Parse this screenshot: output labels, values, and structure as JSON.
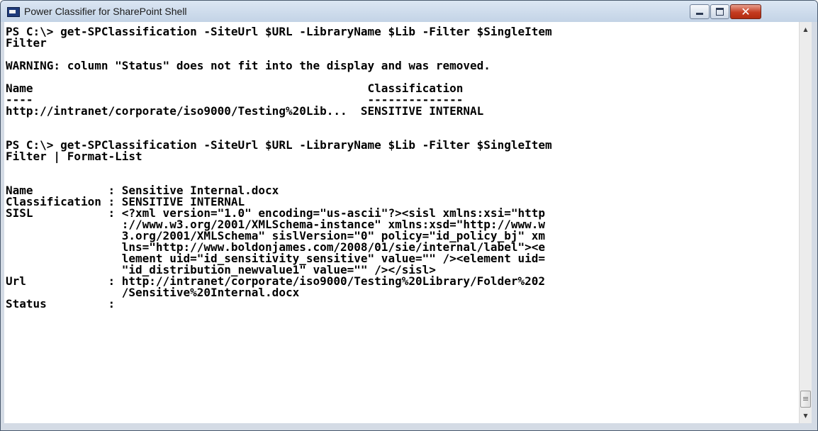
{
  "window": {
    "title": "Power Classifier for SharePoint Shell",
    "controls": {
      "minimize_icon": "minimize-icon",
      "maximize_icon": "maximize-icon",
      "close_icon": "close-icon"
    }
  },
  "console": {
    "lines": [
      "PS C:\\> get-SPClassification -SiteUrl $URL -LibraryName $Lib -Filter $SingleItem",
      "Filter",
      "WARNING: column \"Status\" does not fit into the display and was removed.",
      "Name                                                 Classification",
      "----                                                 --------------",
      "http://intranet/corporate/iso9000/Testing%20Lib...  SENSITIVE INTERNAL",
      "PS C:\\> get-SPClassification -SiteUrl $URL -LibraryName $Lib -Filter $SingleItem",
      "Filter | Format-List",
      "Name           : Sensitive Internal.docx",
      "Classification : SENSITIVE INTERNAL",
      "SISL           : <?xml version=\"1.0\" encoding=\"us-ascii\"?><sisl xmlns:xsi=\"http",
      "                 ://www.w3.org/2001/XMLSchema-instance\" xmlns:xsd=\"http://www.w",
      "                 3.org/2001/XMLSchema\" sislVersion=\"0\" policy=\"id_policy_bj\" xm",
      "                 lns=\"http://www.boldonjames.com/2008/01/sie/internal/label\"><e",
      "                 lement uid=\"id_sensitivity_sensitive\" value=\"\" /><element uid=",
      "                 \"id_distribution_newvalue1\" value=\"\" /></sisl>",
      "Url            : http://intranet/corporate/iso9000/Testing%20Library/Folder%202",
      "                 /Sensitive%20Internal.docx",
      "Status         :"
    ]
  }
}
